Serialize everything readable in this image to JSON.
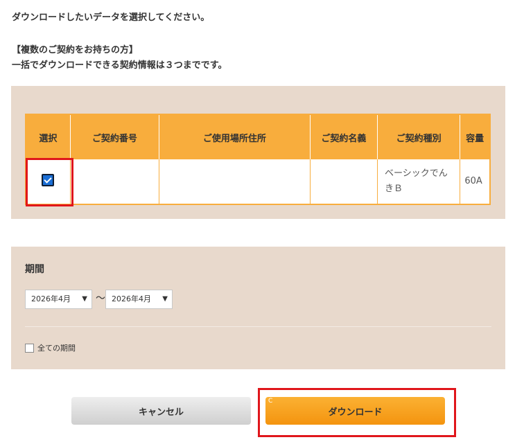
{
  "intro": "ダウンロードしたいデータを選択してください。",
  "note": {
    "line1": "【複数のご契約をお持ちの方】",
    "line2": "一括でダウンロードできる契約情報は３つまでです。"
  },
  "table": {
    "headers": [
      "選択",
      "ご契約番号",
      "ご使用場所住所",
      "ご契約名義",
      "ご契約種別",
      "容量"
    ],
    "rows": [
      {
        "selected": true,
        "contract_number": "",
        "address": "",
        "holder": "",
        "type": "ベーシックでんきＢ",
        "capacity": "60A"
      }
    ]
  },
  "period": {
    "title": "期間",
    "from": "2026年4月",
    "separator": "～",
    "to": "2026年4月",
    "all_label": "全ての期間",
    "all_checked": false
  },
  "buttons": {
    "cancel": "キャンセル",
    "download": "ダウンロード",
    "download_badge": "C"
  },
  "colors": {
    "accent_orange": "#f8ad3d",
    "panel_beige": "#e8d9cc",
    "highlight_red": "#e0161b"
  }
}
